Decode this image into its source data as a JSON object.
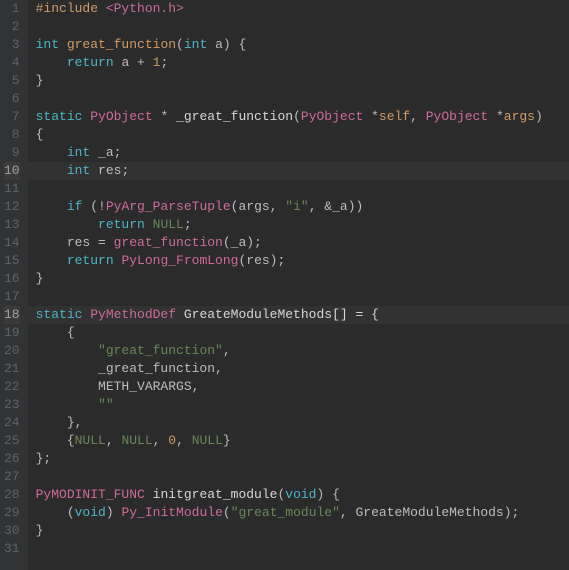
{
  "editor": {
    "line_count": 31,
    "highlighted_lines": [
      10,
      18
    ],
    "code_lines": [
      {
        "tokens": [
          {
            "t": "#include ",
            "c": "macro"
          },
          {
            "t": "<Python.h>",
            "c": "incstr"
          }
        ]
      },
      {
        "tokens": []
      },
      {
        "tokens": [
          {
            "t": "int ",
            "c": "type"
          },
          {
            "t": "great_function",
            "c": "fn"
          },
          {
            "t": "(",
            "c": "punct"
          },
          {
            "t": "int ",
            "c": "type"
          },
          {
            "t": "a",
            "c": "ident"
          },
          {
            "t": ") {",
            "c": "punct"
          }
        ]
      },
      {
        "tokens": [
          {
            "t": "    ",
            "c": ""
          },
          {
            "t": "return ",
            "c": "blue"
          },
          {
            "t": "a ",
            "c": "ident"
          },
          {
            "t": "+ ",
            "c": "punct"
          },
          {
            "t": "1",
            "c": "num"
          },
          {
            "t": ";",
            "c": "punct"
          }
        ]
      },
      {
        "tokens": [
          {
            "t": "}",
            "c": "punct"
          }
        ]
      },
      {
        "tokens": []
      },
      {
        "tokens": [
          {
            "t": "static ",
            "c": "type"
          },
          {
            "t": "PyObject ",
            "c": "call"
          },
          {
            "t": "* ",
            "c": "punct"
          },
          {
            "t": "_great_function",
            "c": "white"
          },
          {
            "t": "(",
            "c": "punct"
          },
          {
            "t": "PyObject ",
            "c": "call"
          },
          {
            "t": "*",
            "c": "punct"
          },
          {
            "t": "self",
            "c": "fn"
          },
          {
            "t": ", ",
            "c": "punct"
          },
          {
            "t": "PyObject ",
            "c": "call"
          },
          {
            "t": "*",
            "c": "punct"
          },
          {
            "t": "args",
            "c": "fn"
          },
          {
            "t": ")",
            "c": "punct"
          }
        ]
      },
      {
        "tokens": [
          {
            "t": "{",
            "c": "punct"
          }
        ]
      },
      {
        "tokens": [
          {
            "t": "    ",
            "c": ""
          },
          {
            "t": "int ",
            "c": "type"
          },
          {
            "t": "_a;",
            "c": "ident"
          }
        ]
      },
      {
        "tokens": [
          {
            "t": "    ",
            "c": ""
          },
          {
            "t": "int ",
            "c": "type"
          },
          {
            "t": "res;",
            "c": "ident"
          }
        ]
      },
      {
        "tokens": []
      },
      {
        "tokens": [
          {
            "t": "    ",
            "c": ""
          },
          {
            "t": "if ",
            "c": "blue"
          },
          {
            "t": "(!",
            "c": "punct"
          },
          {
            "t": "PyArg_ParseTuple",
            "c": "call"
          },
          {
            "t": "(args, ",
            "c": "ident"
          },
          {
            "t": "\"i\"",
            "c": "str"
          },
          {
            "t": ", &_a))",
            "c": "ident"
          }
        ]
      },
      {
        "tokens": [
          {
            "t": "        ",
            "c": ""
          },
          {
            "t": "return ",
            "c": "blue"
          },
          {
            "t": "NULL",
            "c": "null"
          },
          {
            "t": ";",
            "c": "punct"
          }
        ]
      },
      {
        "tokens": [
          {
            "t": "    res = ",
            "c": "ident"
          },
          {
            "t": "great_function",
            "c": "call"
          },
          {
            "t": "(_a);",
            "c": "ident"
          }
        ]
      },
      {
        "tokens": [
          {
            "t": "    ",
            "c": ""
          },
          {
            "t": "return ",
            "c": "blue"
          },
          {
            "t": "PyLong_FromLong",
            "c": "call"
          },
          {
            "t": "(res);",
            "c": "ident"
          }
        ]
      },
      {
        "tokens": [
          {
            "t": "}",
            "c": "punct"
          }
        ]
      },
      {
        "tokens": []
      },
      {
        "tokens": [
          {
            "t": "static ",
            "c": "type"
          },
          {
            "t": "PyMethodDef ",
            "c": "call"
          },
          {
            "t": "GreateModuleMethods[] = {",
            "c": "white"
          }
        ]
      },
      {
        "tokens": [
          {
            "t": "    {",
            "c": "punct"
          }
        ]
      },
      {
        "tokens": [
          {
            "t": "        ",
            "c": ""
          },
          {
            "t": "\"great_function\"",
            "c": "str"
          },
          {
            "t": ",",
            "c": "punct"
          }
        ]
      },
      {
        "tokens": [
          {
            "t": "        _great_function,",
            "c": "ident"
          }
        ]
      },
      {
        "tokens": [
          {
            "t": "        METH_VARARGS,",
            "c": "ident"
          }
        ]
      },
      {
        "tokens": [
          {
            "t": "        ",
            "c": ""
          },
          {
            "t": "\"\"",
            "c": "str"
          }
        ]
      },
      {
        "tokens": [
          {
            "t": "    },",
            "c": "punct"
          }
        ]
      },
      {
        "tokens": [
          {
            "t": "    {",
            "c": "punct"
          },
          {
            "t": "NULL",
            "c": "null"
          },
          {
            "t": ", ",
            "c": "punct"
          },
          {
            "t": "NULL",
            "c": "null"
          },
          {
            "t": ", ",
            "c": "punct"
          },
          {
            "t": "0",
            "c": "num"
          },
          {
            "t": ", ",
            "c": "punct"
          },
          {
            "t": "NULL",
            "c": "null"
          },
          {
            "t": "}",
            "c": "punct"
          }
        ]
      },
      {
        "tokens": [
          {
            "t": "};",
            "c": "punct"
          }
        ]
      },
      {
        "tokens": []
      },
      {
        "tokens": [
          {
            "t": "PyMODINIT_FUNC ",
            "c": "call"
          },
          {
            "t": "initgreat_module",
            "c": "white"
          },
          {
            "t": "(",
            "c": "punct"
          },
          {
            "t": "void",
            "c": "type"
          },
          {
            "t": ") {",
            "c": "punct"
          }
        ]
      },
      {
        "tokens": [
          {
            "t": "    (",
            "c": "punct"
          },
          {
            "t": "void",
            "c": "type"
          },
          {
            "t": ") ",
            "c": "punct"
          },
          {
            "t": "Py_InitModule",
            "c": "call"
          },
          {
            "t": "(",
            "c": "punct"
          },
          {
            "t": "\"great_module\"",
            "c": "str"
          },
          {
            "t": ", GreateModuleMethods);",
            "c": "ident"
          }
        ]
      },
      {
        "tokens": [
          {
            "t": "}",
            "c": "punct"
          }
        ]
      },
      {
        "tokens": []
      }
    ]
  }
}
